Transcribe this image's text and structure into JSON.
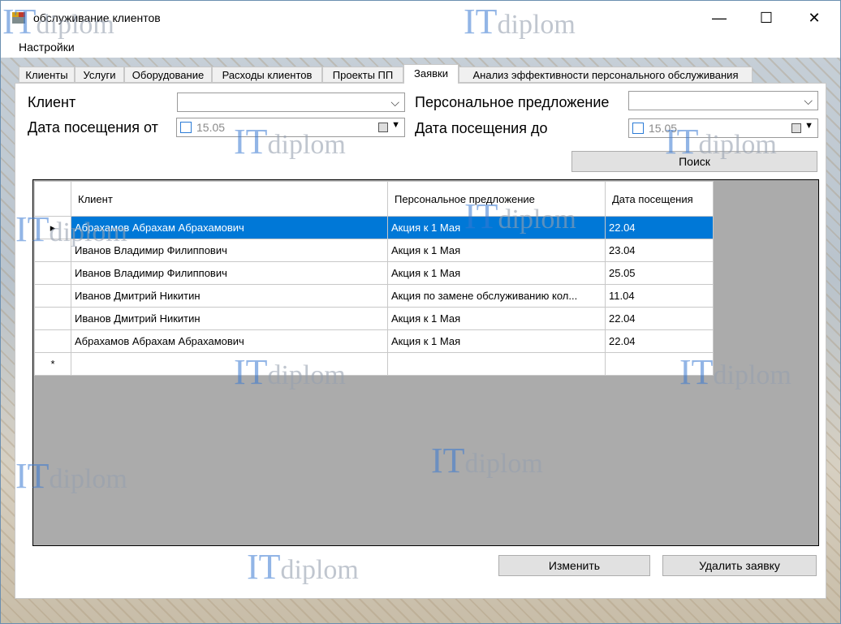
{
  "window": {
    "title": "обслуживание клиентов",
    "min_glyph": "—",
    "max_glyph": "☐",
    "close_glyph": "✕"
  },
  "menu": {
    "settings": "Настройки"
  },
  "tabs": [
    {
      "label": "Клиенты"
    },
    {
      "label": "Услуги"
    },
    {
      "label": "Оборудование"
    },
    {
      "label": "Расходы клиентов"
    },
    {
      "label": "Проекты ПП"
    },
    {
      "label": "Заявки",
      "active": true
    },
    {
      "label": "Анализ эффективности персонального обслуживания"
    }
  ],
  "filters": {
    "client_label": "Клиент",
    "client_value": "",
    "offer_label": "Персональное предложение",
    "offer_value": "",
    "date_from_label": "Дата посещения от",
    "date_from_value": "15.05",
    "date_to_label": "Дата посещения до",
    "date_to_value": "15.05",
    "search_button": "Поиск"
  },
  "grid": {
    "columns": [
      "Клиент",
      "Персональное предложение",
      "Дата посещения"
    ],
    "rows": [
      {
        "client": "Абрахамов Абрахам Абрахамович",
        "offer": "Акция к 1 Мая",
        "date": "22.04",
        "selected": true
      },
      {
        "client": "Иванов Владимир Филиппович",
        "offer": "Акция к 1 Мая",
        "date": "23.04"
      },
      {
        "client": "Иванов Владимир Филиппович",
        "offer": "Акция к 1 Мая",
        "date": "25.05"
      },
      {
        "client": "Иванов Дмитрий Никитин",
        "offer": "Акция по замене обслуживанию кол...",
        "date": "11.04"
      },
      {
        "client": "Иванов Дмитрий Никитин",
        "offer": "Акция к 1 Мая",
        "date": "22.04"
      },
      {
        "client": "Абрахамов Абрахам Абрахамович",
        "offer": "Акция к 1 Мая",
        "date": "22.04"
      }
    ],
    "current_row_marker": "▸",
    "new_row_marker": "*"
  },
  "buttons": {
    "edit": "Изменить",
    "delete": "Удалить заявку"
  },
  "watermark": {
    "it": "IT",
    "diplom": "diplom"
  },
  "colors": {
    "selection": "#0078d7",
    "grid_background": "#ababab"
  }
}
